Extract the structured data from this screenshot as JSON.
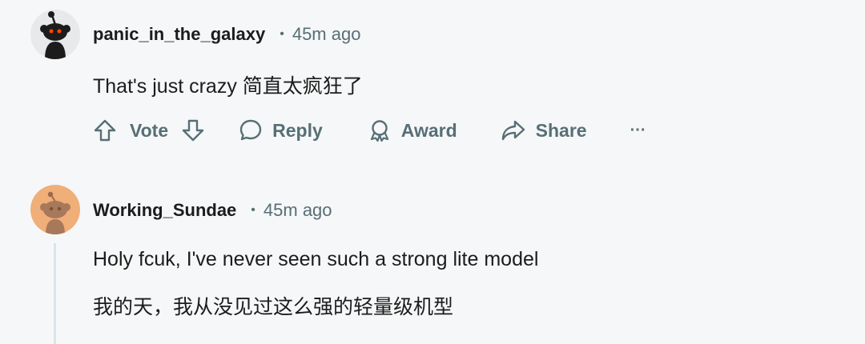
{
  "comments": [
    {
      "username": "panic_in_the_galaxy",
      "separator": "•",
      "time": "45m ago",
      "body": [
        "That's just crazy   简直太疯狂了"
      ],
      "avatar_icon": "snoo-avatar-dark",
      "avatar_bg": "#e7e9ea"
    },
    {
      "username": "Working_Sundae",
      "separator": "•",
      "time": "45m ago",
      "body": [
        "Holy fcuk, I've never seen such a strong lite model",
        "我的天，我从没见过这么强的轻量级机型"
      ],
      "avatar_icon": "snoo-avatar-orange",
      "avatar_bg": "#f0ae78"
    }
  ],
  "actions": {
    "vote_label": "Vote",
    "reply_label": "Reply",
    "award_label": "Award",
    "share_label": "Share",
    "more_label": "···"
  },
  "colors": {
    "background": "#f6f7f8",
    "meta_text": "#576f76",
    "thread_line": "#d6e7ec"
  }
}
